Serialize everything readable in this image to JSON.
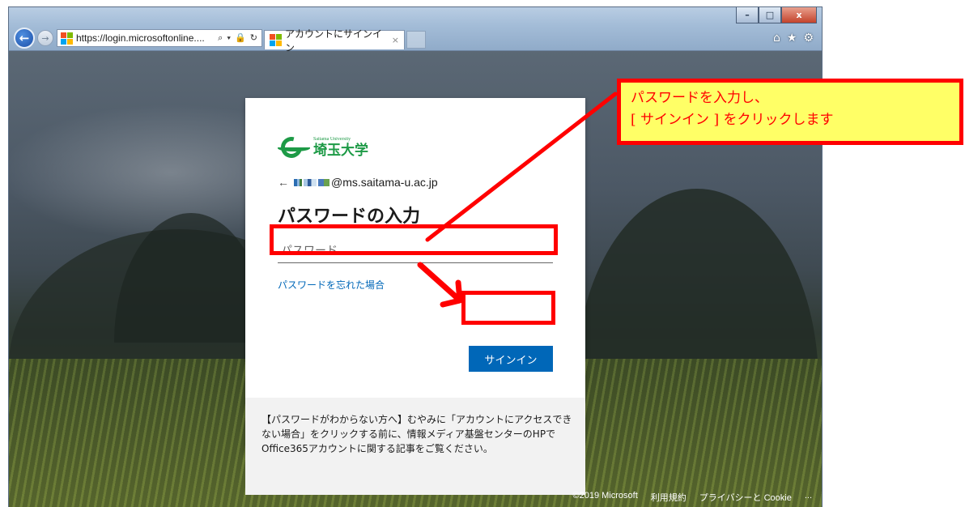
{
  "browser": {
    "url": "https://login.microsoftonline....",
    "address_icons": "⌕ ▾ 🔒 ↻",
    "tab_title": "アカウントにサインイン",
    "tab_close": "×",
    "window_buttons": {
      "minimize": "–",
      "maximize": "□",
      "close": "x"
    },
    "toolbar_icons": [
      "home-icon",
      "star-icon",
      "gear-icon"
    ]
  },
  "signin": {
    "university_small": "Saitama University",
    "university_name": "埼玉大学",
    "back_arrow": "←",
    "email_domain": "@ms.saitama-u.ac.jp",
    "heading": "パスワードの入力",
    "password_placeholder": "パスワード",
    "forgot_link": "パスワードを忘れた場合",
    "signin_button": "サインイン",
    "notice": "【パスワードがわからない方へ】むやみに「アカウントにアクセスできない場合」をクリックする前に、情報メディア基盤センターのHPでOffice365アカウントに関する記事をご覧ください。"
  },
  "footer": {
    "copyright": "©2019 Microsoft",
    "terms": "利用規約",
    "privacy": "プライバシーと Cookie",
    "more": "..."
  },
  "annotation": {
    "line1": "パスワードを入力し、",
    "line2": "[ サインイン ] をクリックします",
    "colors": {
      "highlight": "#ff0000",
      "callout_bg": "#ffff66"
    }
  }
}
